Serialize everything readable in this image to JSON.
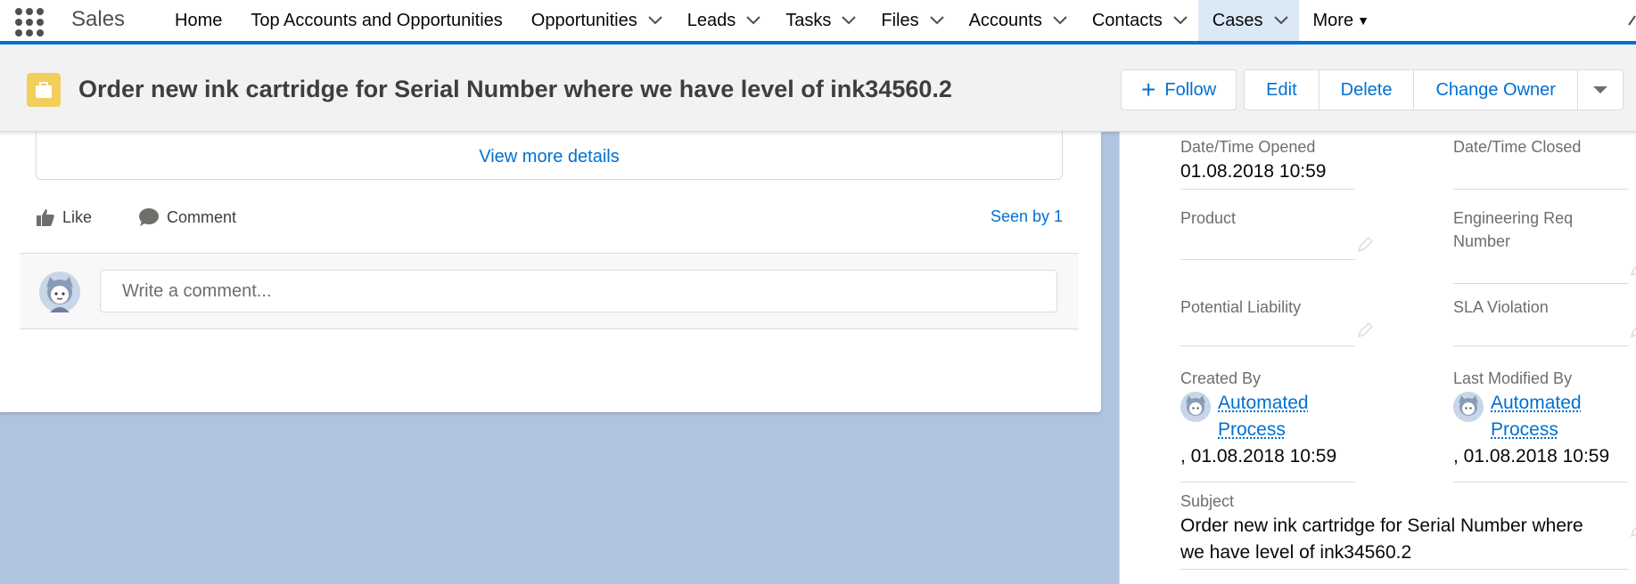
{
  "nav": {
    "app_name": "Sales",
    "items": [
      {
        "label": "Home",
        "has_menu": false
      },
      {
        "label": "Top Accounts and Opportunities",
        "has_menu": false
      },
      {
        "label": "Opportunities",
        "has_menu": true
      },
      {
        "label": "Leads",
        "has_menu": true
      },
      {
        "label": "Tasks",
        "has_menu": true
      },
      {
        "label": "Files",
        "has_menu": true
      },
      {
        "label": "Accounts",
        "has_menu": true
      },
      {
        "label": "Contacts",
        "has_menu": true
      },
      {
        "label": "Cases",
        "has_menu": true,
        "active": true
      },
      {
        "label": "More",
        "has_menu": false
      }
    ]
  },
  "header": {
    "icon": "case-briefcase-icon",
    "title": "Order new ink cartridge for Serial Number where we have level of ink34560.2",
    "actions": {
      "follow": "Follow",
      "edit": "Edit",
      "delete": "Delete",
      "change_owner": "Change Owner"
    }
  },
  "feed": {
    "view_more": "View more details",
    "like": "Like",
    "comment": "Comment",
    "seen_by": "Seen by 1",
    "comment_placeholder": "Write a comment..."
  },
  "details": {
    "date_opened": {
      "label": "Date/Time Opened",
      "value": "01.08.2018 10:59"
    },
    "date_closed": {
      "label": "Date/Time Closed",
      "value": ""
    },
    "product": {
      "label": "Product",
      "value": ""
    },
    "engineering_req": {
      "label": "Engineering Req Number",
      "value": ""
    },
    "potential_liability": {
      "label": "Potential Liability",
      "value": ""
    },
    "sla_violation": {
      "label": "SLA Violation",
      "value": ""
    },
    "created_by": {
      "label": "Created By",
      "user_line1": "Automated",
      "user_line2": "Process",
      "date": ", 01.08.2018 10:59"
    },
    "last_modified_by": {
      "label": "Last Modified By",
      "user_line1": "Automated",
      "user_line2": "Process",
      "date": ", 01.08.2018 10:59"
    },
    "subject": {
      "label": "Subject",
      "value_line1": "Order new ink cartridge for Serial Number where",
      "value_line2": "we have level of ink34560.2"
    }
  },
  "colors": {
    "brand": "#0070d2",
    "case_icon": "#f2cf5b",
    "background": "#b0c4df",
    "active_tab": "#dbe9f7"
  }
}
